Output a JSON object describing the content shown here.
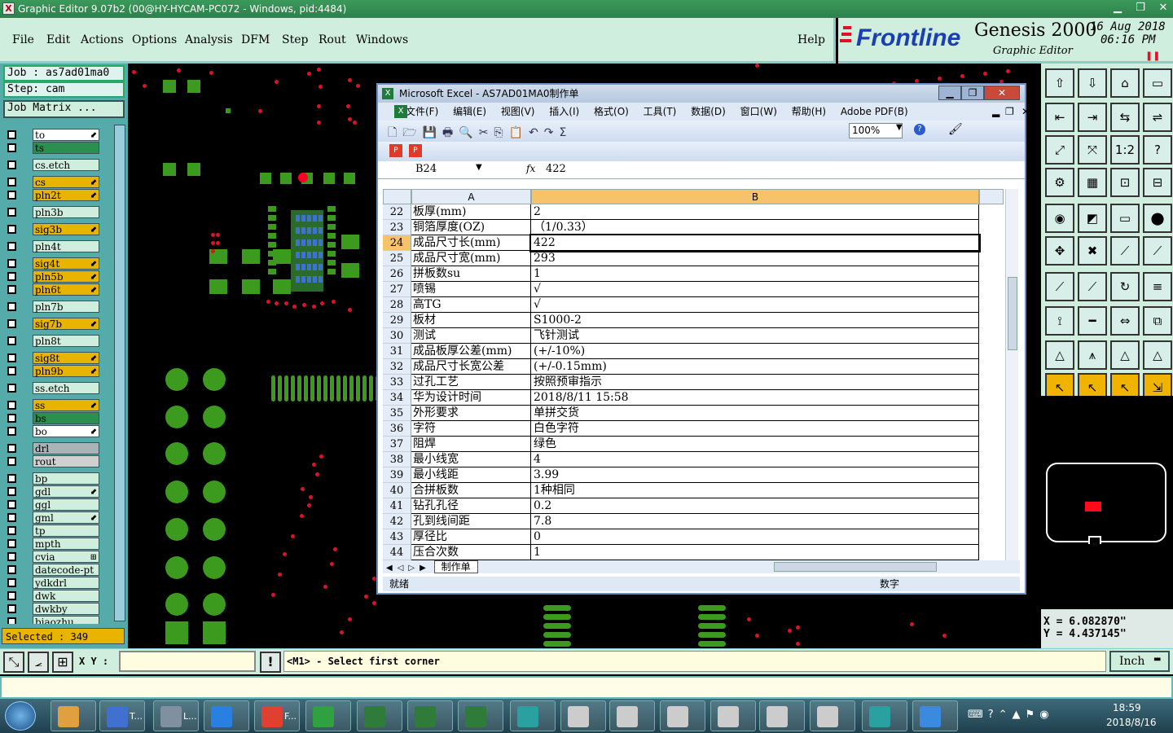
{
  "window": {
    "title": "Graphic Editor 9.07b2 (00@HY-HYCAM-PC072 - Windows, pid:4484)"
  },
  "menu": [
    "File",
    "Edit",
    "Actions",
    "Options",
    "Analysis",
    "DFM",
    "Step",
    "Rout",
    "Windows"
  ],
  "help": "Help",
  "brand": {
    "logo": "Frontline",
    "product": "Genesis 2000",
    "subtitle": "Graphic Editor",
    "date": "16 Aug 2018",
    "time": "06:16 PM"
  },
  "job": {
    "label": "Job : as7ad01ma0",
    "step": "Step: cam",
    "matrix": "Job Matrix ..."
  },
  "layers": [
    {
      "name": "to",
      "bg": "#ffffff",
      "mark": "⬋"
    },
    {
      "name": "ts",
      "bg": "#2a8f4f",
      "mark": ""
    },
    {
      "name": "cs.etch",
      "bg": "#cfeede",
      "mark": ""
    },
    {
      "name": "cs",
      "bg": "#e8b400",
      "mark": "⬋"
    },
    {
      "name": "pln2t",
      "bg": "#e8b400",
      "mark": "⬋"
    },
    {
      "name": "pln3b",
      "bg": "#cfeede",
      "mark": ""
    },
    {
      "name": "sig3b",
      "bg": "#e8b400",
      "mark": "⬋"
    },
    {
      "name": "pln4t",
      "bg": "#cfeede",
      "mark": ""
    },
    {
      "name": "sig4t",
      "bg": "#e8b400",
      "mark": "⬋"
    },
    {
      "name": "pln5b",
      "bg": "#e8b400",
      "mark": "⬋"
    },
    {
      "name": "pln6t",
      "bg": "#e8b400",
      "mark": "⬋"
    },
    {
      "name": "pln7b",
      "bg": "#cfeede",
      "mark": ""
    },
    {
      "name": "sig7b",
      "bg": "#e8b400",
      "mark": "⬋"
    },
    {
      "name": "pln8t",
      "bg": "#cfeede",
      "mark": ""
    },
    {
      "name": "sig8t",
      "bg": "#e8b400",
      "mark": "⬋"
    },
    {
      "name": "pln9b",
      "bg": "#e8b400",
      "mark": "⬋"
    },
    {
      "name": "ss.etch",
      "bg": "#cfeede",
      "mark": ""
    },
    {
      "name": "ss",
      "bg": "#e8b400",
      "mark": "⬋"
    },
    {
      "name": "bs",
      "bg": "#2a8f4f",
      "mark": ""
    },
    {
      "name": "bo",
      "bg": "#ffffff",
      "mark": "⬋"
    },
    {
      "name": "drl",
      "bg": "#a8b4b8",
      "mark": ""
    },
    {
      "name": "rout",
      "bg": "#d0d0d0",
      "mark": ""
    },
    {
      "name": "bp",
      "bg": "#cfeede",
      "mark": ""
    },
    {
      "name": "gdl",
      "bg": "#cfeede",
      "mark": "⬋"
    },
    {
      "name": "ggl",
      "bg": "#cfeede",
      "mark": ""
    },
    {
      "name": "gml",
      "bg": "#cfeede",
      "mark": "⬋"
    },
    {
      "name": "tp",
      "bg": "#cfeede",
      "mark": ""
    },
    {
      "name": "mpth",
      "bg": "#cfeede",
      "mark": ""
    },
    {
      "name": "cvia",
      "bg": "#cfeede",
      "mark": "⊞"
    },
    {
      "name": "datecode-pt",
      "bg": "#cfeede",
      "mark": ""
    },
    {
      "name": "ydkdrl",
      "bg": "#cfeede",
      "mark": ""
    },
    {
      "name": "dwk",
      "bg": "#cfeede",
      "mark": ""
    },
    {
      "name": "dwkby",
      "bg": "#cfeede",
      "mark": ""
    },
    {
      "name": "biaozhu",
      "bg": "#cfeede",
      "mark": ""
    }
  ],
  "selected": "Selected : 349",
  "excel": {
    "title": "Microsoft Excel - AS7AD01MA0制作单",
    "menu": [
      "文件(F)",
      "编辑(E)",
      "视图(V)",
      "插入(I)",
      "格式(O)",
      "工具(T)",
      "数据(D)",
      "窗口(W)",
      "帮助(H)",
      "Adobe PDF(B)"
    ],
    "zoom": "100%",
    "cell_ref": "B24",
    "fx": "fx",
    "formula_value": "422",
    "col_a": "A",
    "col_b": "B",
    "rows": [
      {
        "n": "22",
        "a": "板厚(mm)",
        "b": "2"
      },
      {
        "n": "23",
        "a": "铜箔厚度(OZ)",
        "b": "（1/0.33）"
      },
      {
        "n": "24",
        "a": "成品尺寸长(mm)",
        "b": "422"
      },
      {
        "n": "25",
        "a": "成品尺寸宽(mm)",
        "b": "293"
      },
      {
        "n": "26",
        "a": "拼板数su",
        "b": "1"
      },
      {
        "n": "27",
        "a": "喷锡",
        "b": "√"
      },
      {
        "n": "28",
        "a": "高TG",
        "b": "√"
      },
      {
        "n": "29",
        "a": "板材",
        "b": "S1000-2"
      },
      {
        "n": "30",
        "a": "测试",
        "b": "飞针测试"
      },
      {
        "n": "31",
        "a": "成品板厚公差(mm)",
        "b": "(+/-10%)"
      },
      {
        "n": "32",
        "a": "成品尺寸长宽公差",
        "b": "(+/-0.15mm)"
      },
      {
        "n": "33",
        "a": "过孔工艺",
        "b": "按照预审指示"
      },
      {
        "n": "34",
        "a": "华为设计时间",
        "b": "2018/8/11 15:58"
      },
      {
        "n": "35",
        "a": "外形要求",
        "b": "单拼交货"
      },
      {
        "n": "36",
        "a": "字符",
        "b": "白色字符"
      },
      {
        "n": "37",
        "a": "阻焊",
        "b": "绿色"
      },
      {
        "n": "38",
        "a": "最小线宽",
        "b": "4"
      },
      {
        "n": "39",
        "a": "最小线距",
        "b": "3.99"
      },
      {
        "n": "40",
        "a": "合拼板数",
        "b": "1种相同"
      },
      {
        "n": "41",
        "a": "钻孔孔径",
        "b": "0.2"
      },
      {
        "n": "42",
        "a": "孔到线间距",
        "b": "7.8"
      },
      {
        "n": "43",
        "a": "厚径比",
        "b": "0"
      },
      {
        "n": "44",
        "a": "压合次数",
        "b": "1"
      }
    ],
    "sheet_tab": "制作单",
    "status_left": "就绪",
    "status_num": "数字"
  },
  "coords": {
    "x": "X  =  6.082870\"",
    "y": "Y  =  4.437145\""
  },
  "cmd": {
    "xy_label": "X Y :",
    "prompt": "<M1> - Select first corner",
    "unit": "Inch"
  },
  "taskbar": {
    "apps": [
      "T...",
      "L...",
      "F..."
    ],
    "clock_time": "18:59",
    "clock_date": "2018/8/16"
  }
}
